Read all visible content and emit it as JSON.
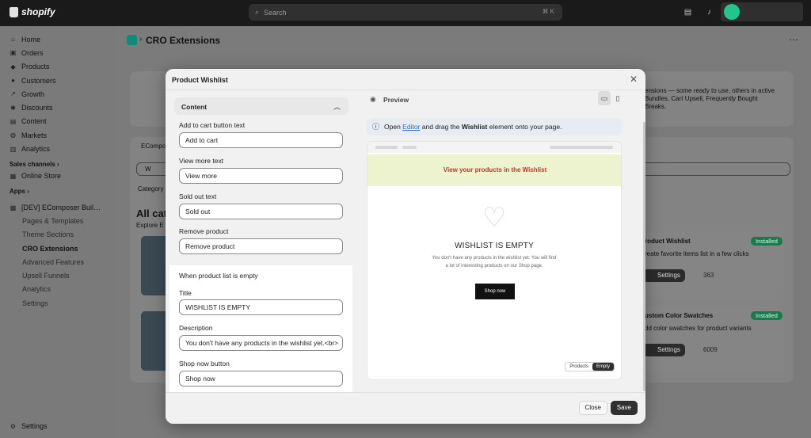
{
  "topbar": {
    "brand": "shopify",
    "search_placeholder": "Search",
    "search_shortcut": "⌘ K"
  },
  "sidebar": {
    "items": [
      {
        "label": "Home",
        "icon": "home-icon",
        "glyph": "⌂"
      },
      {
        "label": "Orders",
        "icon": "orders-icon",
        "glyph": "▣"
      },
      {
        "label": "Products",
        "icon": "products-icon",
        "glyph": "◆"
      },
      {
        "label": "Customers",
        "icon": "customers-icon",
        "glyph": "●"
      },
      {
        "label": "Growth",
        "icon": "growth-icon",
        "glyph": "↗"
      },
      {
        "label": "Discounts",
        "icon": "discounts-icon",
        "glyph": "✱"
      },
      {
        "label": "Content",
        "icon": "content-icon",
        "glyph": "▤"
      },
      {
        "label": "Markets",
        "icon": "markets-icon",
        "glyph": "◍"
      },
      {
        "label": "Analytics",
        "icon": "analytics-icon",
        "glyph": "▥"
      }
    ],
    "sales_channels_label": "Sales channels",
    "online_store": "Online Store",
    "apps_label": "Apps",
    "app_name": "[DEV] EComposer Buil…",
    "app_subitems": [
      "Pages & Templates",
      "Theme Sections",
      "CRO Extensions",
      "Advanced Features",
      "Upsell Funnels",
      "Analytics",
      "Settings"
    ],
    "settings": "Settings"
  },
  "page": {
    "title": "CRO Extensions",
    "bg_desc": "ensions — some ready to use, others in active\nBundles, Cart Upsell, Frequently Bought\nBreaks.",
    "bg_tab": "ECompo",
    "bg_search": "W",
    "bg_category": "Category",
    "bg_all": "All cat",
    "bg_explore": "Explore E",
    "card1_title": "roduct Wishlist",
    "card1_desc": "reate favorite items list in a few clicks",
    "card1_badge": "Installed",
    "card1_settings": "Settings",
    "card1_count": "363",
    "card2_title": "ustom Color Swatches",
    "card2_desc": "dd color swatches for product variants",
    "card2_badge": "Installed",
    "card2_settings": "Settings",
    "card2_count": "6009"
  },
  "modal": {
    "title": "Product Wishlist",
    "close_label": "Close",
    "save_label": "Save",
    "content_section": "Content",
    "fields": {
      "add_to_cart_label": "Add to cart button text",
      "add_to_cart_value": "Add to cart",
      "view_more_label": "View more text",
      "view_more_value": "View more",
      "sold_out_label": "Sold out text",
      "sold_out_value": "Sold out",
      "remove_label": "Remove product",
      "remove_value": "Remove product"
    },
    "empty_section": {
      "heading": "When product list is empty",
      "title_label": "Title",
      "title_value": "WISHLIST IS EMPTY",
      "desc_label": "Description",
      "desc_value": "You don't have any products in the wishlist yet.<br>",
      "shop_label": "Shop now button",
      "shop_value": "Shop now"
    },
    "preview": {
      "label": "Preview",
      "info_prefix": "Open",
      "info_link": "Editor",
      "info_middle": "and drag the",
      "info_bold": "Wishlist",
      "info_suffix": "element onto your page.",
      "banner": "View your products in the Wishlist",
      "empty_title": "WISHLIST IS EMPTY",
      "empty_desc": "You don't have any products in the wishlist yet. You will find a lot of interesting products on our Shop page.",
      "empty_btn": "Shop now",
      "toggle_products": "Products",
      "toggle_empty": "Empty"
    }
  },
  "colors": {
    "accent_dark": "#303030",
    "link": "#2c6ecb",
    "banner_text": "#c0392b",
    "badge": "#1a7a4e"
  }
}
